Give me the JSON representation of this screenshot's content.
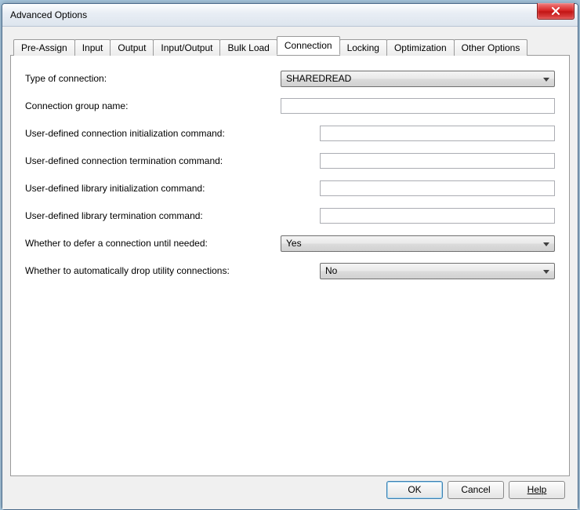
{
  "window": {
    "title": "Advanced Options"
  },
  "tabs": [
    {
      "label": "Pre-Assign"
    },
    {
      "label": "Input"
    },
    {
      "label": "Output"
    },
    {
      "label": "Input/Output"
    },
    {
      "label": "Bulk Load"
    },
    {
      "label": "Connection"
    },
    {
      "label": "Locking"
    },
    {
      "label": "Optimization"
    },
    {
      "label": "Other Options"
    }
  ],
  "active_tab_index": 5,
  "form": {
    "type_of_connection": {
      "label": "Type of connection:",
      "value": "SHAREDREAD"
    },
    "connection_group_name": {
      "label": "Connection group name:",
      "value": ""
    },
    "user_conn_init_cmd": {
      "label": "User-defined connection initialization command:",
      "value": ""
    },
    "user_conn_term_cmd": {
      "label": "User-defined connection termination command:",
      "value": ""
    },
    "user_lib_init_cmd": {
      "label": "User-defined library initialization command:",
      "value": ""
    },
    "user_lib_term_cmd": {
      "label": "User-defined library termination command:",
      "value": ""
    },
    "defer_connection": {
      "label": "Whether to defer a connection until needed:",
      "value": "Yes"
    },
    "auto_drop_utility": {
      "label": "Whether to automatically drop utility connections:",
      "value": "No"
    }
  },
  "buttons": {
    "ok": "OK",
    "cancel": "Cancel",
    "help": "Help"
  }
}
